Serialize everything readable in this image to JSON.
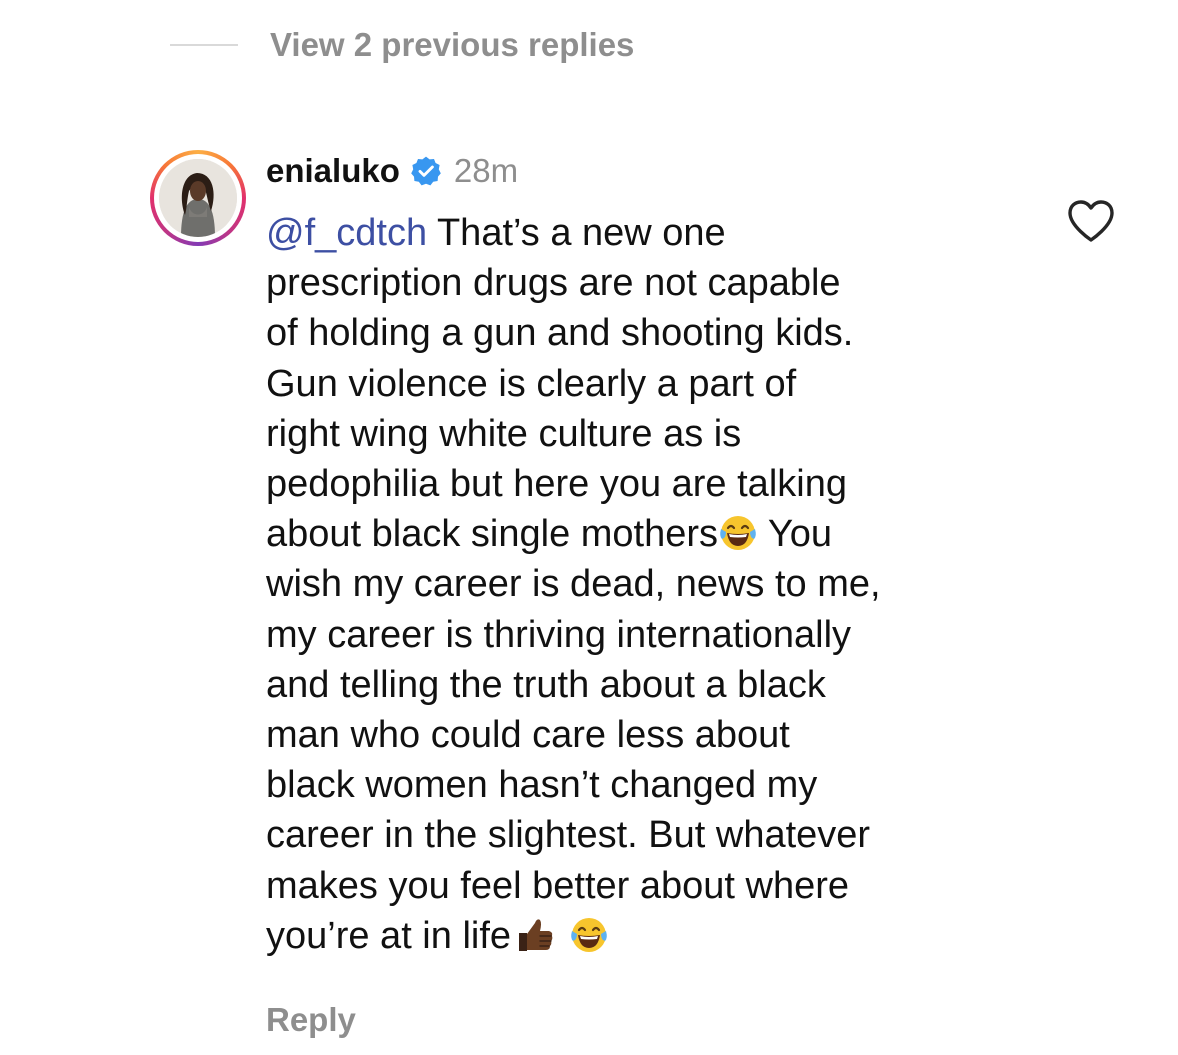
{
  "thread": {
    "view_previous_replies": "View 2 previous replies"
  },
  "comment": {
    "username": "enialuko",
    "verified": true,
    "time": "28m",
    "mention": "@f_cdtch",
    "lines": {
      "l1": "That’s a new one",
      "l2": "prescription drugs are not capable",
      "l3": "of holding a gun and shooting kids.",
      "l4": "Gun violence is clearly a part of",
      "l5": "right wing white culture as is",
      "l6": "pedophilia but here you are talking",
      "l7a": "about black single mothers",
      "l7b": " You",
      "l8": "wish my career is dead, news to me,",
      "l9": "my career is thriving internationally",
      "l10": "and telling the truth about a black",
      "l11": "man who could care less about",
      "l12": "black women hasn’t changed my",
      "l13": "career in the slightest. But whatever",
      "l14": "makes you feel better about where",
      "l15": "you’re at in life"
    },
    "emojis": [
      "laughing-tears-emoji",
      "thumbs-up-emoji",
      "laughing-tears-emoji"
    ],
    "reply_label": "Reply"
  },
  "icons": {
    "like": "heart-outline-icon",
    "verified": "verified-badge-icon"
  },
  "colors": {
    "secondary_text": "#8e8e8e",
    "mention": "#3d4fa3",
    "verified_blue": "#3897f0"
  }
}
